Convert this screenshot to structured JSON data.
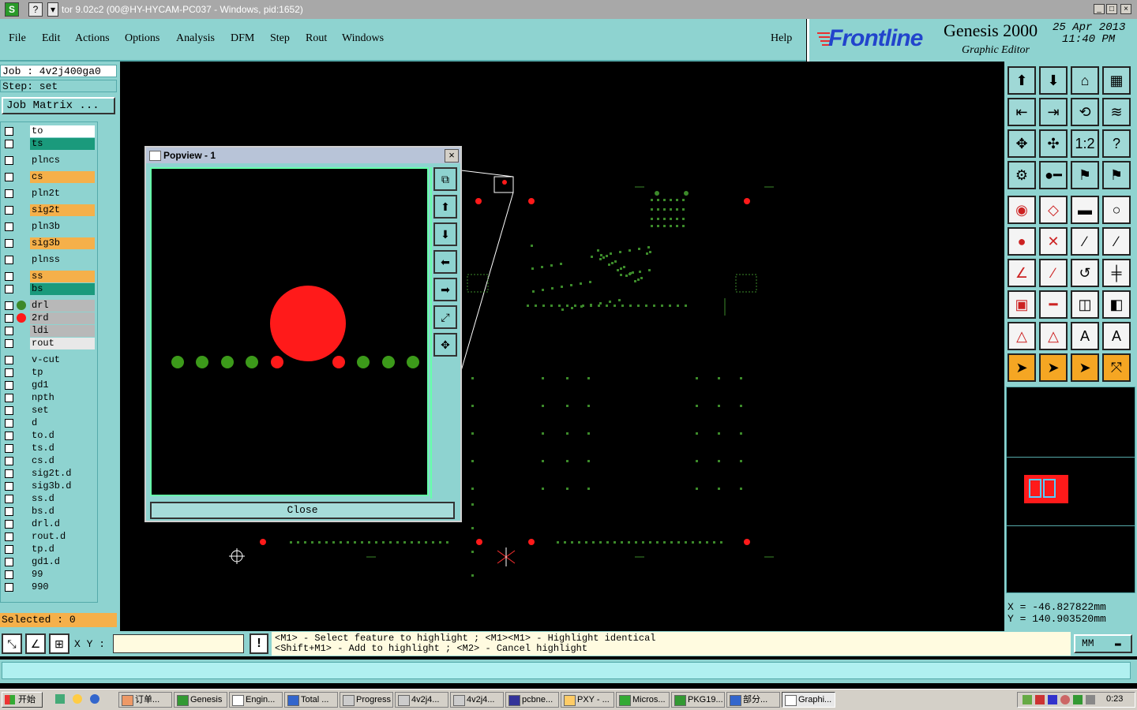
{
  "window": {
    "title": "tor 9.02c2 (00@HY-HYCAM-PC037 - Windows, pid:1652)",
    "app_icon": "S",
    "help_icon": "?",
    "min": "_",
    "max": "□",
    "close": "×"
  },
  "menu": {
    "items": [
      "File",
      "Edit",
      "Actions",
      "Options",
      "Analysis",
      "DFM",
      "Step",
      "Rout",
      "Windows"
    ],
    "help": "Help"
  },
  "brand": {
    "logo": "Frontline",
    "product": "Genesis 2000",
    "subtitle": "Graphic Editor",
    "date": "25 Apr 2013",
    "time": "11:40 PM"
  },
  "job": {
    "job_line": "Job : 4v2j400ga0",
    "step_line": "Step: set",
    "matrix_button": "Job Matrix ..."
  },
  "layers": [
    {
      "name": "to",
      "color": "#ffffff"
    },
    {
      "name": "ts",
      "color": "#1a9a7c"
    },
    {
      "name": "plncs",
      "color": "#8ed3d0"
    },
    {
      "name": "cs",
      "color": "#f5b04a"
    },
    {
      "name": "pln2t",
      "color": "#8ed3d0"
    },
    {
      "name": "sig2t",
      "color": "#f5b04a"
    },
    {
      "name": "pln3b",
      "color": "#8ed3d0"
    },
    {
      "name": "sig3b",
      "color": "#f5b04a"
    },
    {
      "name": "plnss",
      "color": "#8ed3d0"
    },
    {
      "name": "ss",
      "color": "#f5b04a"
    },
    {
      "name": "bs",
      "color": "#1a9a7c"
    },
    {
      "name": "drl",
      "color": "#b8b8b8",
      "marker": "#3c8a2a"
    },
    {
      "name": "2rd",
      "color": "#b8b8b8",
      "marker": "#ff1a1a"
    },
    {
      "name": "ldi",
      "color": "#b8b8b8"
    },
    {
      "name": "rout",
      "color": "#e8e8e8"
    },
    {
      "name": "v-cut",
      "color": "#8ed3d0"
    },
    {
      "name": "tp",
      "color": "#8ed3d0"
    },
    {
      "name": "gd1",
      "color": "#8ed3d0"
    },
    {
      "name": "npth",
      "color": "#8ed3d0"
    },
    {
      "name": "set",
      "color": "#8ed3d0"
    },
    {
      "name": "d",
      "color": "#8ed3d0"
    },
    {
      "name": "to.d",
      "color": "#8ed3d0"
    },
    {
      "name": "ts.d",
      "color": "#8ed3d0"
    },
    {
      "name": "cs.d",
      "color": "#8ed3d0"
    },
    {
      "name": "sig2t.d",
      "color": "#8ed3d0"
    },
    {
      "name": "sig3b.d",
      "color": "#8ed3d0"
    },
    {
      "name": "ss.d",
      "color": "#8ed3d0"
    },
    {
      "name": "bs.d",
      "color": "#8ed3d0"
    },
    {
      "name": "drl.d",
      "color": "#8ed3d0"
    },
    {
      "name": "rout.d",
      "color": "#8ed3d0"
    },
    {
      "name": "tp.d",
      "color": "#8ed3d0"
    },
    {
      "name": "gd1.d",
      "color": "#8ed3d0"
    },
    {
      "name": "99",
      "color": "#8ed3d0"
    },
    {
      "name": "990",
      "color": "#8ed3d0"
    }
  ],
  "selected": "Selected : 0",
  "popview": {
    "title": "Popview - 1",
    "close_label": "Close"
  },
  "coords": {
    "x": "X = -46.827822mm",
    "y": "Y = 140.903520mm"
  },
  "xy_label": "X Y :",
  "xy_input": "",
  "prompt": {
    "line1": "<M1> - Select feature to highlight ; <M1><M1> - Highlight identical",
    "line2": "<Shift+M1> - Add to highlight ; <M2> - Cancel highlight"
  },
  "units": "MM",
  "taskbar": {
    "start": "开始",
    "tasks": [
      "订单...",
      "Genesis",
      "Engin...",
      "Total ...",
      "Progress",
      "4v2j4...",
      "4v2j4...",
      "pcbne...",
      "PXY - ...",
      "Micros...",
      "PKG19...",
      "部分...",
      "Graphi..."
    ],
    "clock": "0:23"
  },
  "colors": {
    "panel": "#8ed3d0",
    "drill_green": "#3c8a2a",
    "pad_red": "#ff1a1a",
    "brand_blue": "#2244cc"
  }
}
